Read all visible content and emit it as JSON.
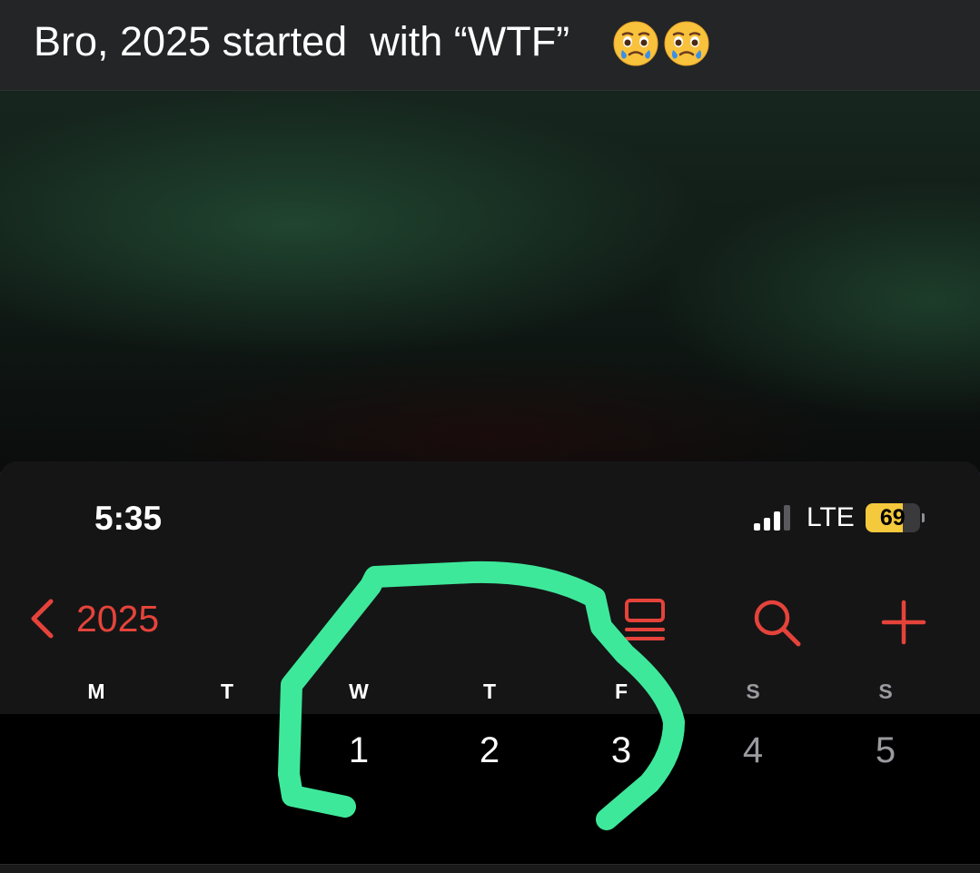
{
  "post": {
    "caption": "Bro, 2025 started  with “WTF”",
    "emojis": [
      "face-holding-back-tears-emoji",
      "face-holding-back-tears-emoji"
    ]
  },
  "status_bar": {
    "time": "5:35",
    "network": "LTE",
    "battery_level": "69",
    "battery_fraction": 0.69
  },
  "calendar": {
    "back_label": "2025",
    "toolbar_icons": [
      "list-view-icon",
      "search-icon",
      "add-icon"
    ],
    "weekdays": [
      "M",
      "T",
      "W",
      "T",
      "F",
      "S",
      "S"
    ],
    "dates": [
      "",
      "",
      "1",
      "2",
      "3",
      "4",
      "5"
    ]
  },
  "colors": {
    "accent_red": "#e5433a",
    "scribble_green": "#3ee89a",
    "battery_yellow": "#f4c93c"
  }
}
